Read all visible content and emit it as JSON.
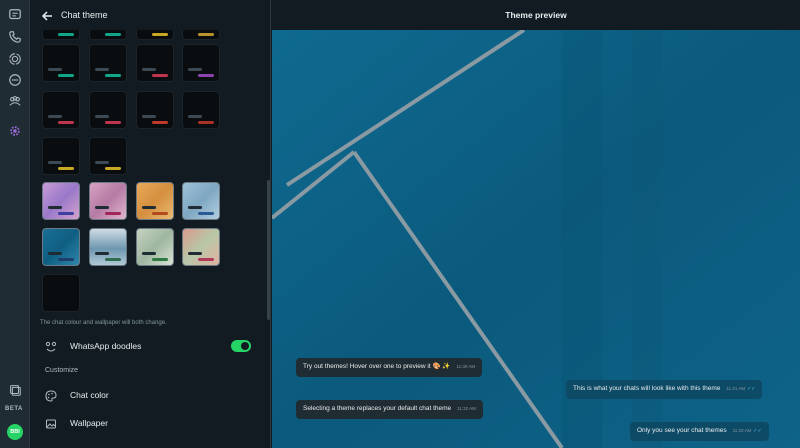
{
  "rail": {
    "icons": [
      "chats-icon",
      "calls-icon",
      "status-icon",
      "channels-icon",
      "communities-icon",
      "settings-icon",
      "archive-icon",
      "settings-gear-icon"
    ],
    "beta_label": "BETA",
    "avatar_text": "BBI"
  },
  "panel": {
    "title": "Chat theme",
    "note": "The chat colour and wallpaper will both change.",
    "doodles_label": "WhatsApp doodles",
    "doodles_on": true,
    "customize_label": "Customize",
    "chat_color_label": "Chat color",
    "wallpaper_label": "Wallpaper",
    "colors": {
      "green": "#25d366",
      "teal": "#12a689",
      "yellow": "#c9a923",
      "red": "#c0344d",
      "orange": "#c0392b",
      "gold": "#b9932e"
    }
  },
  "preview": {
    "title": "Theme preview",
    "messages": [
      {
        "dir": "in",
        "text": "Try out themes! Hover over one to preview it 🎨 ✨",
        "time": "11:30 AM"
      },
      {
        "dir": "out",
        "text": "This is what your chats will look like with this theme",
        "time": "11:31 AM"
      },
      {
        "dir": "in",
        "text": "Selecting a theme replaces your default chat theme",
        "time": "11:32 AM"
      },
      {
        "dir": "out",
        "text": "Only you see your chat themes",
        "time": "11:33 AM"
      }
    ]
  }
}
